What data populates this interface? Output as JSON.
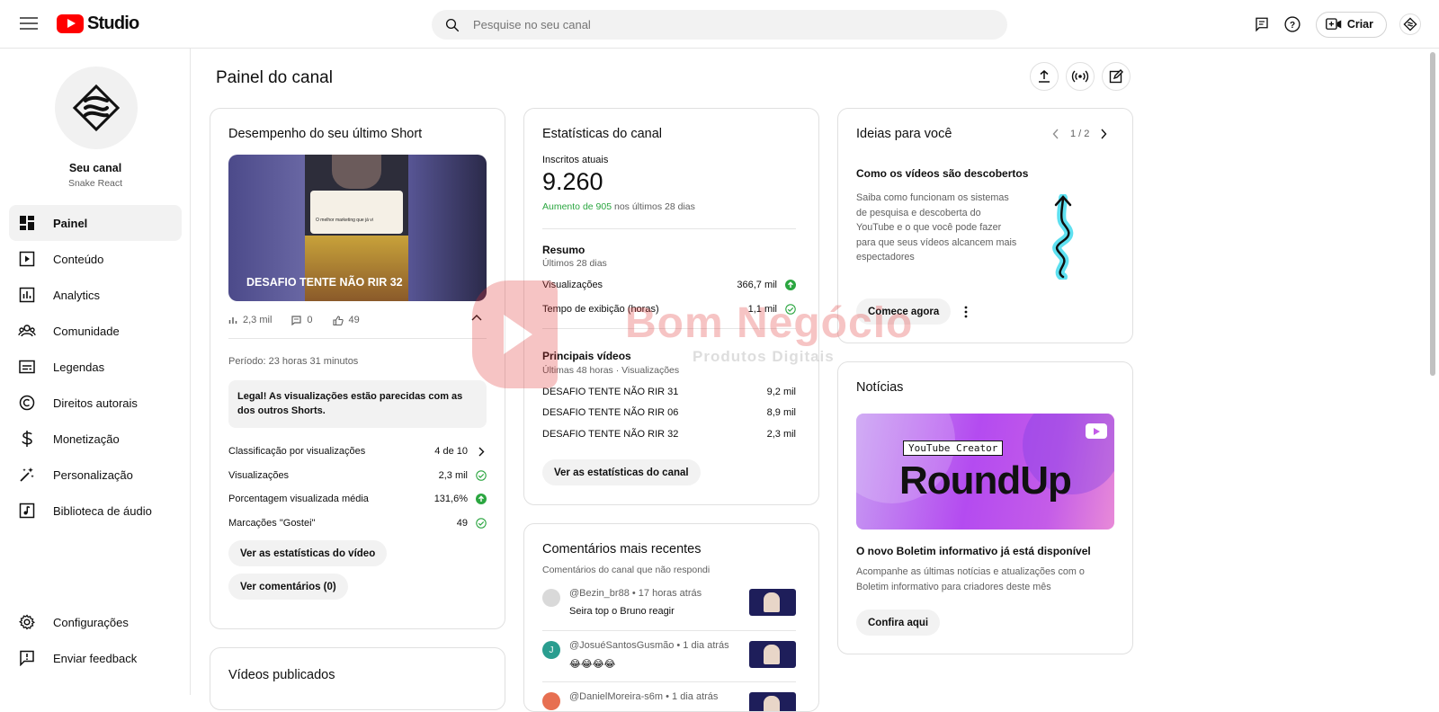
{
  "header": {
    "logo_text": "Studio",
    "search_placeholder": "Pesquise no seu canal",
    "create_label": "Criar"
  },
  "sidebar": {
    "channel_title": "Seu canal",
    "channel_name": "Snake React",
    "items": [
      {
        "label": "Painel",
        "icon": "dashboard-icon",
        "active": true
      },
      {
        "label": "Conteúdo",
        "icon": "content-icon"
      },
      {
        "label": "Analytics",
        "icon": "analytics-icon"
      },
      {
        "label": "Comunidade",
        "icon": "community-icon"
      },
      {
        "label": "Legendas",
        "icon": "subtitles-icon"
      },
      {
        "label": "Direitos autorais",
        "icon": "copyright-icon"
      },
      {
        "label": "Monetização",
        "icon": "dollar-icon"
      },
      {
        "label": "Personalização",
        "icon": "magic-wand-icon"
      },
      {
        "label": "Biblioteca de áudio",
        "icon": "audio-library-icon"
      }
    ],
    "bottom_items": [
      {
        "label": "Configurações",
        "icon": "gear-icon"
      },
      {
        "label": "Enviar feedback",
        "icon": "feedback-icon"
      }
    ]
  },
  "main": {
    "title": "Painel do canal"
  },
  "short_card": {
    "title": "Desempenho do seu último Short",
    "thumb_title": "DESAFIO TENTE NÃO RIR 32",
    "thumb_post_text": "O melhor marketing que já vi",
    "views": "2,3 mil",
    "comments": "0",
    "likes": "49",
    "period": "Período: 23 horas 31 minutos",
    "insight": "Legal! As visualizações estão parecidas com as dos outros Shorts.",
    "stats": [
      {
        "label": "Classificação por visualizações",
        "value": "4 de 10",
        "icon": "chevron-right-icon"
      },
      {
        "label": "Visualizações",
        "value": "2,3 mil",
        "icon": "check-circle-icon"
      },
      {
        "label": "Porcentagem visualizada média",
        "value": "131,6%",
        "icon": "arrow-up-circle-icon"
      },
      {
        "label": "Marcações \"Gostei\"",
        "value": "49",
        "icon": "check-circle-icon"
      }
    ],
    "btn_stats": "Ver as estatísticas do vídeo",
    "btn_comments": "Ver comentários (0)"
  },
  "published_card": {
    "title": "Vídeos publicados"
  },
  "channel_stats": {
    "title": "Estatísticas do canal",
    "subs_label": "Inscritos atuais",
    "subs_value": "9.260",
    "subs_growth_highlight": "Aumento de 905",
    "subs_growth_rest": " nos últimos 28 dias",
    "summary_title": "Resumo",
    "summary_period": "Últimos 28 dias",
    "summary": [
      {
        "label": "Visualizações",
        "value": "366,7 mil",
        "icon": "arrow-up-circle-icon"
      },
      {
        "label": "Tempo de exibição (horas)",
        "value": "1,1 mil",
        "icon": "check-circle-icon"
      }
    ],
    "top_title": "Principais vídeos",
    "top_period": "Últimas 48 horas · Visualizações",
    "top_videos": [
      {
        "title": "DESAFIO TENTE NÃO RIR 31",
        "views": "9,2 mil"
      },
      {
        "title": "DESAFIO TENTE NÃO RIR 06",
        "views": "8,9 mil"
      },
      {
        "title": "DESAFIO TENTE NÃO RIR 32",
        "views": "2,3 mil"
      }
    ],
    "btn": "Ver as estatísticas do canal"
  },
  "comments_card": {
    "title": "Comentários mais recentes",
    "subtitle": "Comentários do canal que não respondi",
    "comments": [
      {
        "meta": "@Bezin_br88 • 17 horas atrás",
        "text": "Seira top o Bruno reagir",
        "avatar_color": "#d9d9d9",
        "initial": ""
      },
      {
        "meta": "@JosuéSantosGusmão • 1 dia atrás",
        "text": "😂😂😂😂",
        "avatar_color": "#2a9d8f",
        "initial": "J"
      },
      {
        "meta": "@DanielMoreira-s6m • 1 dia atrás",
        "text": "",
        "avatar_color": "#e76f51",
        "initial": ""
      }
    ]
  },
  "ideas_card": {
    "title": "Ideias para você",
    "pager": "1 / 2",
    "subtitle": "Como os vídeos são descobertos",
    "body": "Saiba como funcionam os sistemas de pesquisa e descoberta do YouTube e o que você pode fazer para que seus vídeos alcancem mais espectadores",
    "btn": "Comece agora"
  },
  "news_card": {
    "title": "Notícias",
    "banner_tag": "YouTube Creator",
    "banner_title": "RoundUp",
    "headline": "O novo Boletim informativo já está disponível",
    "body": "Acompanhe as últimas notícias e atualizações com o Boletim informativo para criadores deste mês",
    "btn": "Confira aqui"
  },
  "watermark": {
    "title": "Bom Negócio",
    "subtitle": "Produtos Digitais"
  },
  "colors": {
    "brand_red": "#ff0000",
    "success_green": "#2ba640",
    "banner_purple": "#b44bf0"
  }
}
